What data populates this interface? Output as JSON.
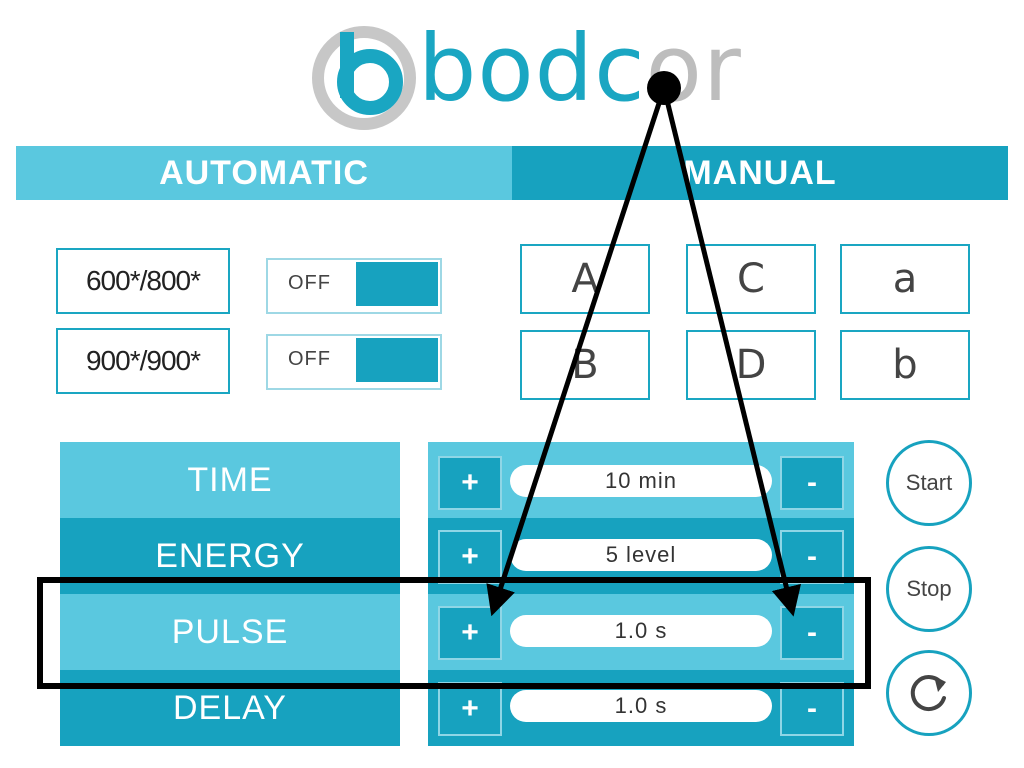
{
  "logo": {
    "text_main": "bodc",
    "text_faded": "or"
  },
  "tabs": [
    {
      "label": "AUTOMATIC"
    },
    {
      "label": "MANUAL"
    }
  ],
  "presets": [
    {
      "label": "600*/800*",
      "toggle": "OFF"
    },
    {
      "label": "900*/900*",
      "toggle": "OFF"
    }
  ],
  "letters": [
    "A",
    "C",
    "a",
    "B",
    "D",
    "b"
  ],
  "params": [
    {
      "label": "TIME",
      "value": "10 min",
      "plus": "+",
      "minus": "-"
    },
    {
      "label": "ENERGY",
      "value": "5 level",
      "plus": "+",
      "minus": "-"
    },
    {
      "label": "PULSE",
      "value": "1.0 s",
      "plus": "+",
      "minus": "-"
    },
    {
      "label": "DELAY",
      "value": "1.0 s",
      "plus": "+",
      "minus": "-"
    }
  ],
  "actions": {
    "start": "Start",
    "stop": "Stop",
    "reset_icon": "refresh-icon"
  },
  "colors": {
    "light_blue": "#5ac8df",
    "dark_blue": "#17a2bf",
    "logo_gray": "#bdbdbd"
  }
}
